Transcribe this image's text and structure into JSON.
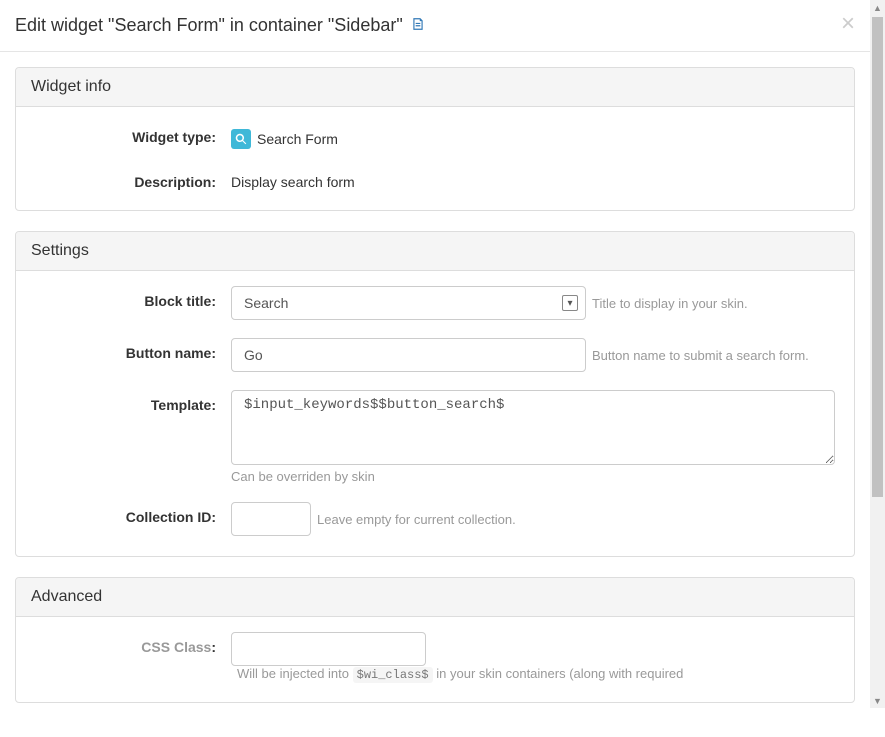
{
  "header": {
    "title": "Edit widget \"Search Form\" in container \"Sidebar\"",
    "close_symbol": "×"
  },
  "widget_info": {
    "heading": "Widget info",
    "type_label": "Widget type:",
    "type_value": "Search Form",
    "description_label": "Description:",
    "description_value": "Display search form"
  },
  "settings": {
    "heading": "Settings",
    "block_title_label": "Block title:",
    "block_title_value": "Search",
    "block_title_help": "Title to display in your skin.",
    "button_name_label": "Button name:",
    "button_name_value": "Go",
    "button_name_help": "Button name to submit a search form.",
    "template_label": "Template:",
    "template_value": "$input_keywords$$button_search$",
    "template_help": "Can be overriden by skin",
    "collection_id_label": "Collection ID:",
    "collection_id_value": "",
    "collection_id_help": "Leave empty for current collection."
  },
  "advanced": {
    "heading": "Advanced",
    "css_class_label": "CSS Class",
    "css_class_value": "",
    "css_class_help_prefix": "Will be injected into ",
    "css_class_help_code": "$wi_class$",
    "css_class_help_suffix": " in your skin containers (along with required "
  }
}
